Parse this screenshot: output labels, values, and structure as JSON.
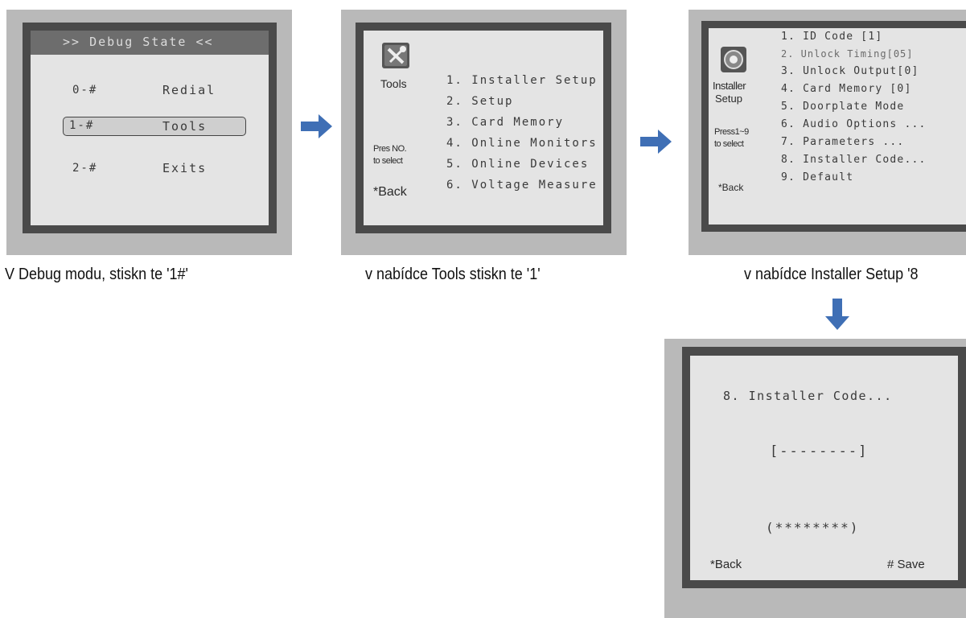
{
  "screen1": {
    "title": ">> Debug State <<",
    "items": [
      {
        "key": "0-#",
        "label": "Redial"
      },
      {
        "key": "1-#",
        "label": "Tools"
      },
      {
        "key": "2-#",
        "label": "Exits"
      }
    ],
    "caption": "V Debug modu, stiskn  te '1#'"
  },
  "screen2": {
    "icon_label": "Tools",
    "prompt_line1": "Pres NO.",
    "prompt_line2": "to select",
    "back": "*Back",
    "items": [
      "1. Installer Setup",
      "2. Setup",
      "3. Card Memory",
      "4. Online Monitors",
      "5. Online Devices",
      "6. Voltage Measure"
    ],
    "caption": "v nabídce Tools stiskn  te '1'"
  },
  "screen3": {
    "icon_label_line1": "Installer",
    "icon_label_line2": "Setup",
    "prompt_line1": "Press1~9",
    "prompt_line2": "to select",
    "back": "*Back",
    "items": [
      "1. ID Code     [1]",
      "2. Unlock Timing[05]",
      "3. Unlock Output[0]",
      "4. Card Memory [0]",
      "5. Doorplate Mode",
      "6. Audio Options ...",
      "7. Parameters ...",
      "8. Installer Code...",
      "9. Default"
    ],
    "caption": "v nabídce Installer Setup '8"
  },
  "screen4": {
    "title": "8. Installer Code...",
    "input": "[--------]",
    "password": "(********)",
    "back": "*Back",
    "save": "# Save"
  },
  "colors": {
    "arrow": "#3f6fb5",
    "panel": "#b9b9b9",
    "frame": "#4a4a4a",
    "screen": "#e4e4e4"
  }
}
